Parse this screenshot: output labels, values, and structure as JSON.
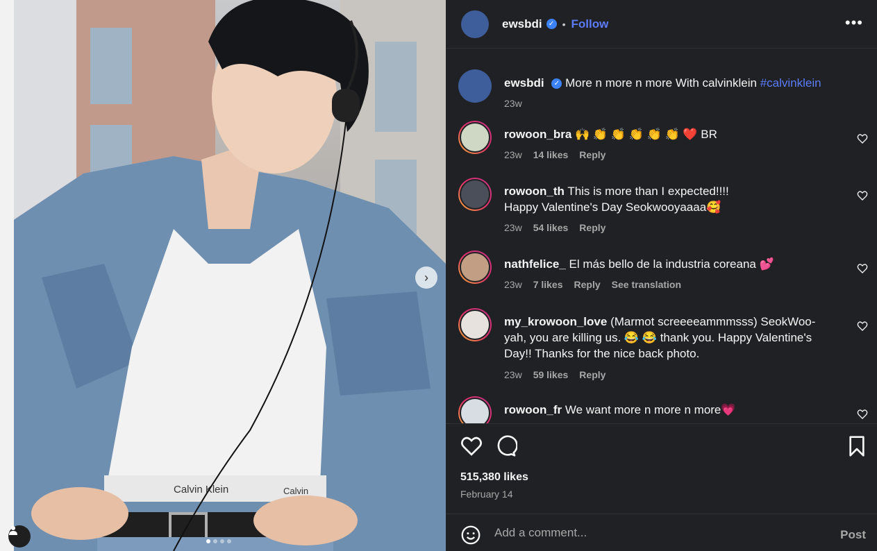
{
  "post": {
    "username": "ewsbdi",
    "follow_label": "Follow",
    "more_label": "•••",
    "separator": "•",
    "caption": {
      "username": "ewsbdi",
      "text": "More n more n more With calvinklein",
      "hashtag": "#calvinklein",
      "time": "23w"
    },
    "likes": "515,380 likes",
    "date": "February 14"
  },
  "photo": {
    "brand_text": "Calvin Klein",
    "brand_text_2": "Calvin",
    "next_label": "›",
    "carousel_count": 4,
    "carousel_active_index": 1
  },
  "comments": [
    {
      "username": "rowoon_bra",
      "text": "🙌 👏 👏 👏 👏 👏 ❤️ BR",
      "time": "23w",
      "likes": "14 likes",
      "reply": "Reply"
    },
    {
      "username": "rowoon_th",
      "text": "This is more than I expected!!!!",
      "text2": "Happy Valentine's Day Seokwooyaaaa🥰",
      "time": "23w",
      "likes": "54 likes",
      "reply": "Reply"
    },
    {
      "username": "nathfelice_",
      "text": "El más bello de la industria coreana 💕",
      "time": "23w",
      "likes": "7 likes",
      "reply": "Reply",
      "translate": "See translation"
    },
    {
      "username": "my_krowoon_love",
      "text": "(Marmot screeeeammmsss) SeokWoo-yah, you are killing us. 😂 😂  thank you. Happy Valentine's Day!! Thanks for the nice back photo.",
      "time": "23w",
      "likes": "59 likes",
      "reply": "Reply"
    },
    {
      "username": "rowoon_fr",
      "text": "We want more n more n more💗"
    }
  ],
  "comment_bar": {
    "placeholder": "Add a comment...",
    "post_label": "Post"
  },
  "icons": {
    "verified": "verified-badge-icon",
    "like": "heart-icon",
    "comment": "comment-bubble-icon",
    "save": "bookmark-icon",
    "emoji": "smiley-icon",
    "tag": "user-tag-icon"
  },
  "colors": {
    "panel_bg": "#202124",
    "link_blue": "#5c7cfa",
    "muted": "#a8a8a8"
  }
}
